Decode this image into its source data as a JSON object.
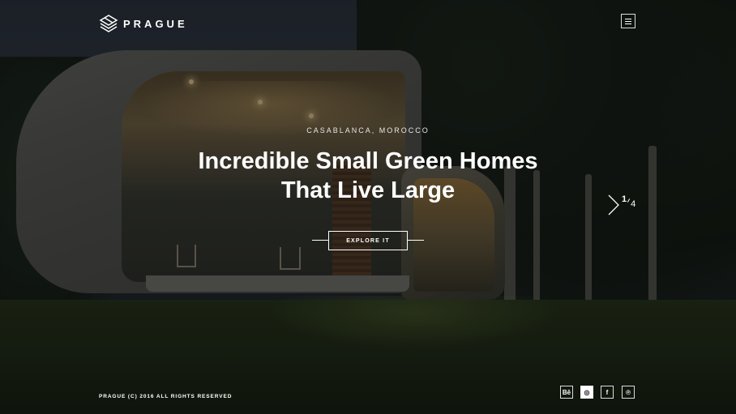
{
  "brand": {
    "name": "PRAGUE",
    "logo_icon": "cube-logo-icon"
  },
  "header": {
    "menu_icon": "hamburger-icon"
  },
  "hero": {
    "location": "CASABLANCA, MOROCCO",
    "headline_line1": "Incredible Small Green Homes",
    "headline_line2": "That Live Large",
    "cta_label": "EXPLORE IT"
  },
  "slider": {
    "next_icon": "chevron-right-icon",
    "current": "1",
    "total": "4"
  },
  "footer": {
    "copyright": "PRAGUE (C) 2016 ALL RIGHTS RESERVED",
    "social": [
      {
        "name": "behance",
        "label": "Bē"
      },
      {
        "name": "dribbble",
        "label": "◎"
      },
      {
        "name": "facebook",
        "label": "f"
      },
      {
        "name": "pinterest",
        "label": "℗"
      }
    ]
  },
  "colors": {
    "text": "#ffffff",
    "overlay": "#080a0c",
    "active_social_bg": "#ffffff"
  }
}
